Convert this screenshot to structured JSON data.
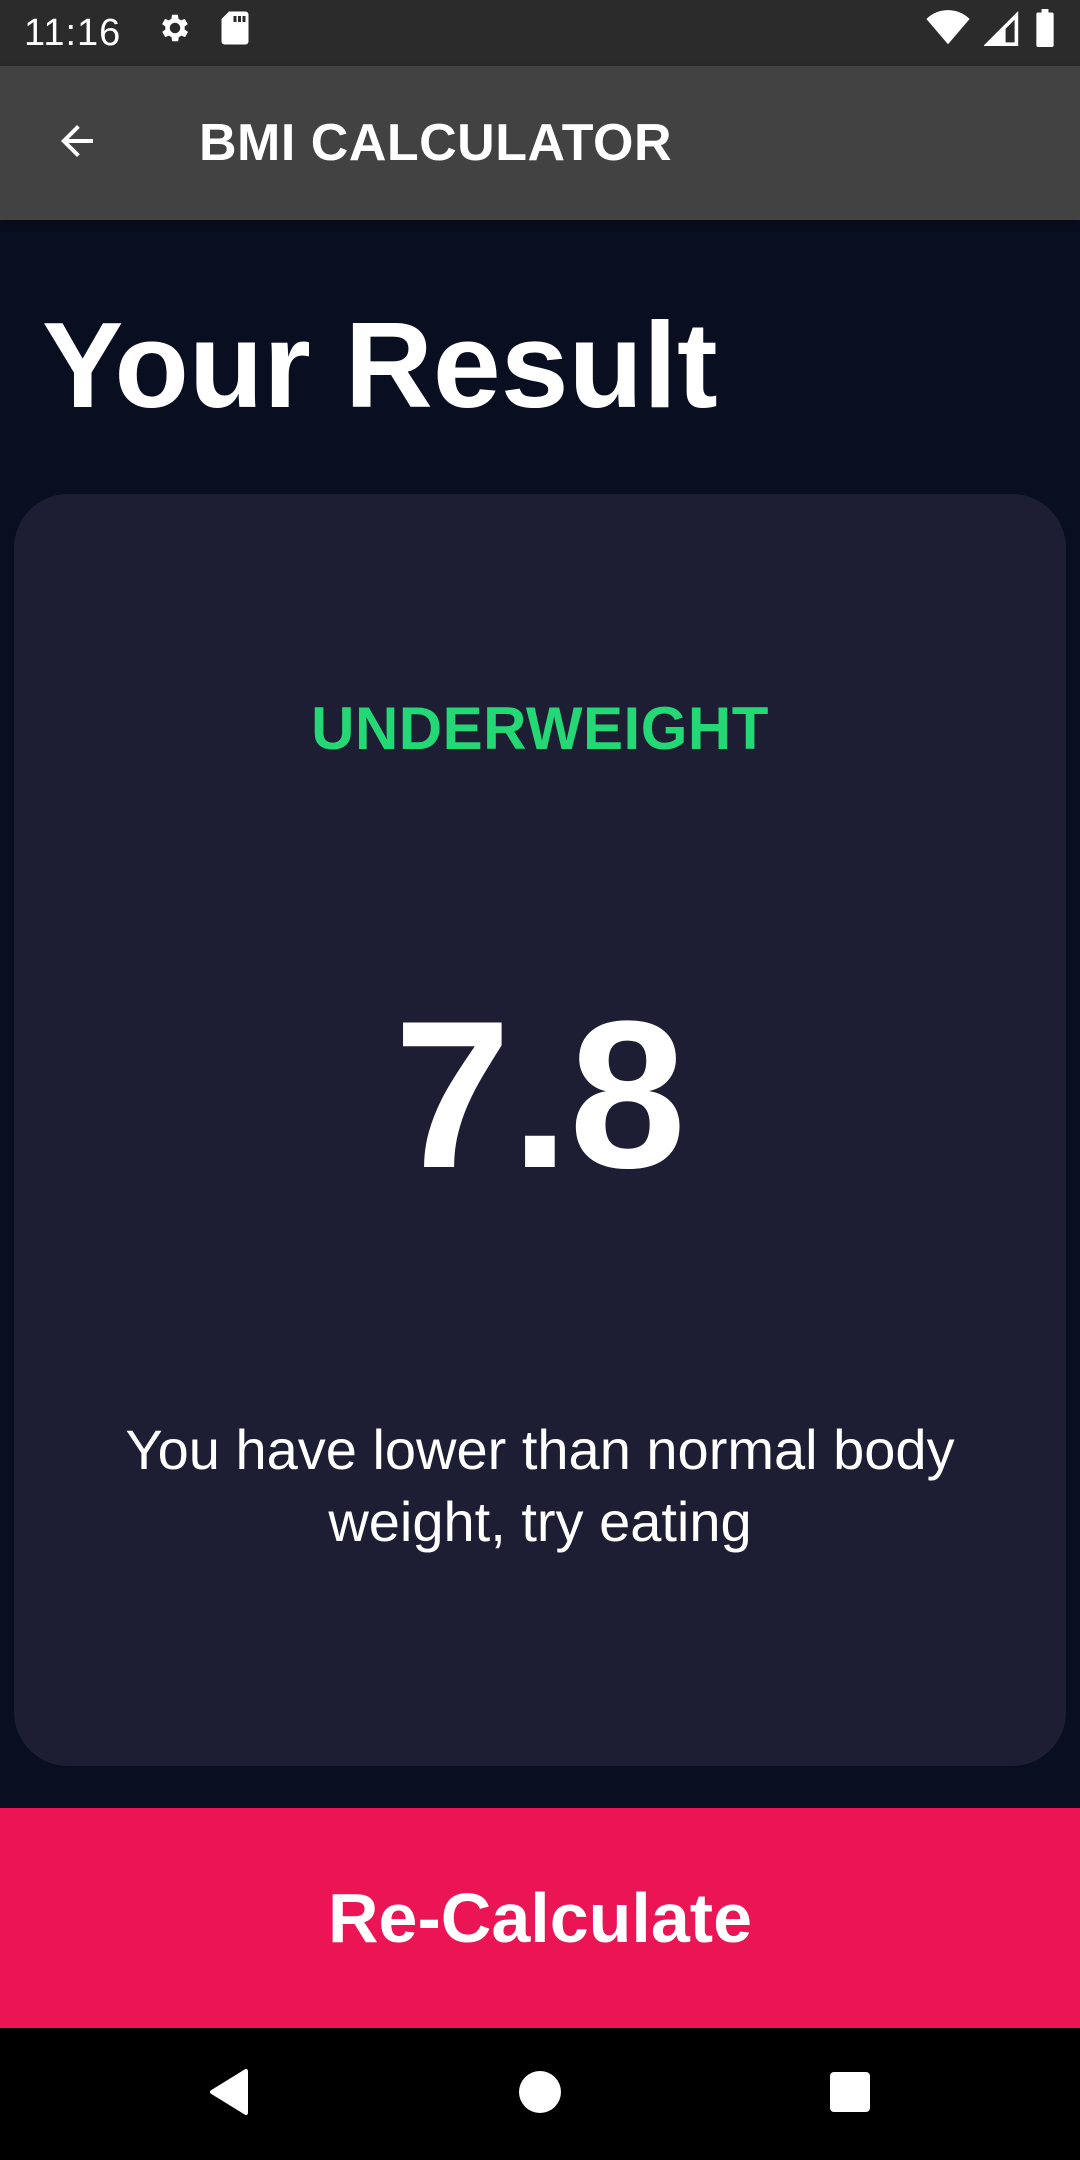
{
  "status_bar": {
    "time": "11:16",
    "icons": [
      "gear-icon",
      "sd-card-icon",
      "wifi-icon",
      "signal-icon",
      "battery-icon"
    ]
  },
  "app_bar": {
    "title": "BMI CALCULATOR",
    "back_icon": "arrow-left-icon"
  },
  "page": {
    "title": "Your Result"
  },
  "result": {
    "status": "UNDERWEIGHT",
    "value": "7.8",
    "message": "You have lower than normal body weight, try eating"
  },
  "actions": {
    "recalculate_label": "Re-Calculate"
  },
  "nav_bar": {
    "icons": [
      "back-triangle-icon",
      "home-circle-icon",
      "recents-square-icon"
    ]
  },
  "colors": {
    "background": "#0a0e21",
    "card": "#1d1e33",
    "accent_green": "#24d876",
    "button_pink": "#eb1555",
    "app_bar": "#424242"
  }
}
